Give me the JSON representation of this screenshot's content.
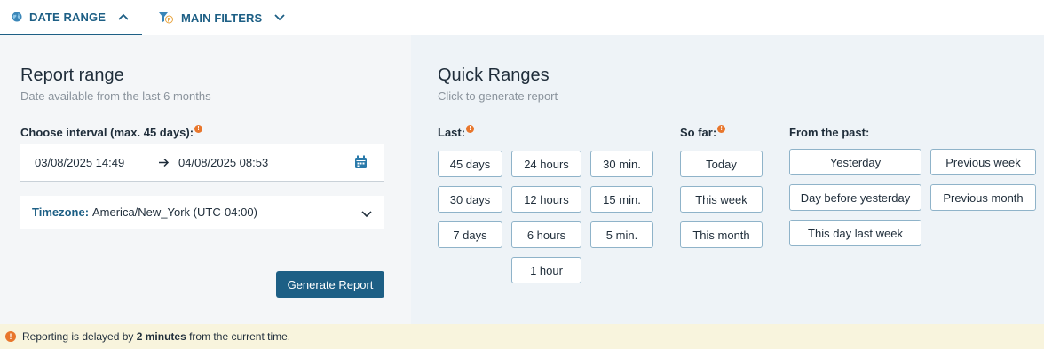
{
  "tabs": {
    "date_range": "DATE RANGE",
    "main_filters": "MAIN FILTERS"
  },
  "report_range": {
    "title": "Report range",
    "subtitle": "Date available from the last 6 months",
    "interval_label": "Choose interval (max. 45 days):",
    "info_marker": "!",
    "from": "03/08/2025 14:49",
    "to": "04/08/2025 08:53",
    "timezone_label": "Timezone:",
    "timezone_value": "America/New_York (UTC-04:00)",
    "generate_button": "Generate Report"
  },
  "quick_ranges": {
    "title": "Quick Ranges",
    "subtitle": "Click to generate report",
    "last_label": "Last:",
    "so_far_label": "So far:",
    "from_past_label": "From the past:",
    "last_col1": [
      "45 days",
      "30 days",
      "7 days"
    ],
    "last_col2": [
      "24 hours",
      "12 hours",
      "6 hours",
      "1 hour"
    ],
    "last_col3": [
      "30 min.",
      "15 min.",
      "5 min."
    ],
    "so_far": [
      "Today",
      "This week",
      "This month"
    ],
    "from_past_col1": [
      "Yesterday",
      "Day before yesterday",
      "This day last week"
    ],
    "from_past_col2": [
      "Previous week",
      "Previous month"
    ]
  },
  "banner": {
    "icon": "!",
    "prefix": "Reporting is delayed by ",
    "bold": "2 minutes",
    "suffix": " from the current time."
  },
  "colors": {
    "accent": "#1d5f85",
    "warning": "#e8762c",
    "banner_bg": "#f8f4dd"
  }
}
